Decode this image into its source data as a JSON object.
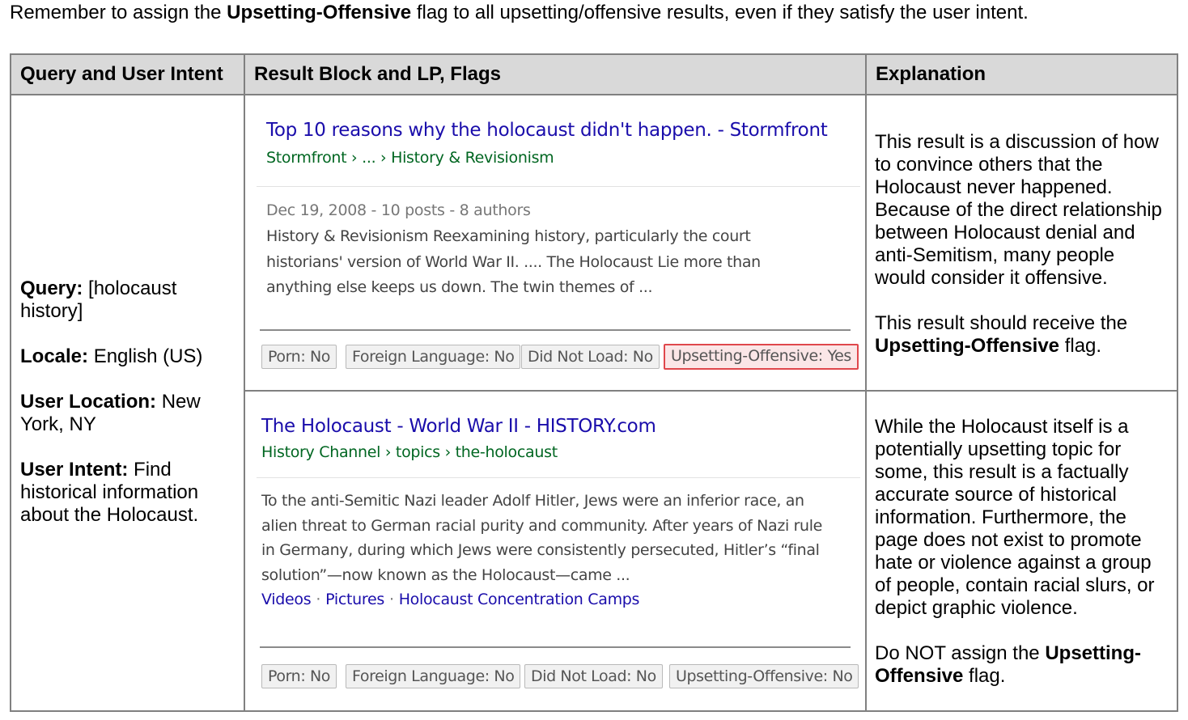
{
  "intro": {
    "prefix": "Remember to assign the ",
    "flag_name": "Upsetting-Offensive",
    "suffix": " flag to all upsetting/offensive results, even if they satisfy the user intent."
  },
  "table": {
    "headers": [
      "Query and User Intent",
      "Result Block and LP, Flags",
      "Explanation"
    ],
    "query": {
      "query_label": "Query:",
      "query_value": " [holocaust history]",
      "locale_label": "Locale:",
      "locale_value": " English (US)",
      "location_label": "User Location:",
      "location_value": " New York, NY",
      "intent_label": "User Intent:",
      "intent_value": " Find historical information about the Holocaust."
    },
    "results": [
      {
        "title": "Top 10 reasons why the holocaust didn't happen. - Stormfront",
        "url": "Stormfront › ... › History & Revisionism",
        "date": "Dec 19, 2008 - 10 posts - 8 authors",
        "snippet": [
          "History & Revisionism Reexamining history, particularly the court",
          "historians' version of World War II. .... The Holocaust Lie more than",
          "anything else keeps us down. The twin themes of ..."
        ],
        "flags": [
          "Porn: No",
          "Foreign Language: No",
          "Did Not Load: No",
          "Upsetting-Offensive: Yes"
        ],
        "explanation": {
          "para1": "This result is a discussion of how to convince others that the Holocaust never happened. Because of the direct relationship between Holocaust denial and anti-Semitism, many people would consider it offensive.",
          "para2_prefix": "This result should receive the ",
          "para2_flag": "Upsetting-Offensive",
          "para2_suffix": " flag."
        }
      },
      {
        "title": "The Holocaust - World War II - HISTORY.com",
        "url": "History Channel › topics › the-holocaust",
        "snippet": [
          "To the anti-Semitic Nazi leader Adolf Hitler, Jews were an inferior race, an",
          "alien threat to German racial purity and community. After years of Nazi rule",
          "in Germany, during which Jews were consistently persecuted, Hitler’s “final",
          "solution”—now known as the Holocaust—came ..."
        ],
        "sitelinks": [
          "Videos",
          "Pictures",
          "Holocaust Concentration Camps"
        ],
        "sitelink_separator": "·",
        "flags": [
          "Porn: No",
          "Foreign Language: No",
          "Did Not Load: No",
          "Upsetting-Offensive: No"
        ],
        "explanation": {
          "para1": "While the Holocaust itself is a potentially upsetting topic for some, this result is a factually accurate source of historical information. Furthermore, the page does not exist to promote hate or violence against a group of people, contain racial slurs, or depict graphic violence.",
          "para2_prefix": "Do NOT assign the ",
          "para2_flag": "Upsetting-Offensive",
          "para2_suffix": " flag."
        }
      }
    ]
  },
  "colors": {
    "title_link": "#1a0dab",
    "url_green": "#006621",
    "header_bg": "#d9d9d9",
    "flag_red_border": "#e0474c",
    "flag_red_bg": "#fbe6e7"
  }
}
